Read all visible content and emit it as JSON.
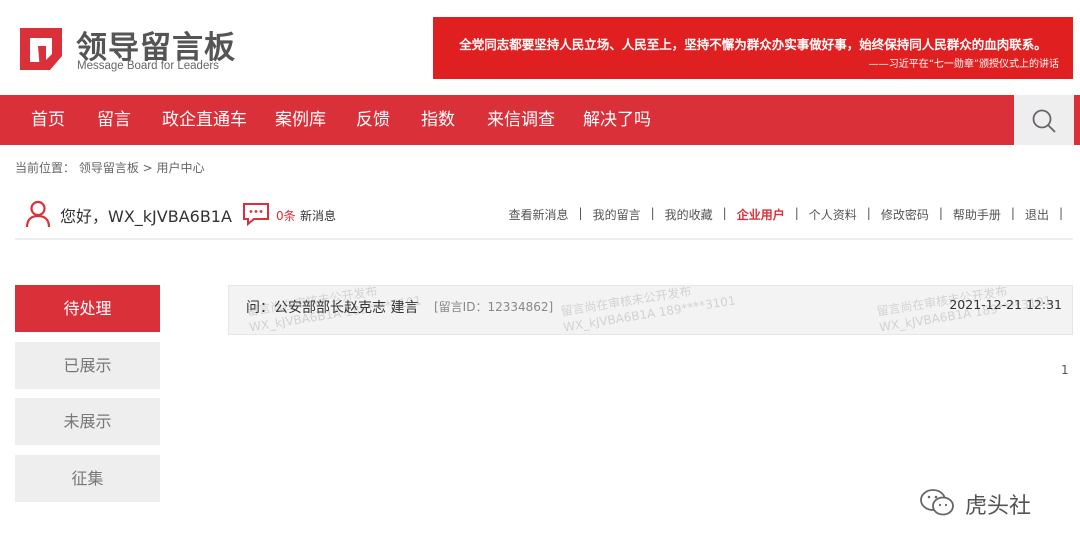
{
  "header": {
    "logo_title": "领导留言板",
    "logo_subtitle": "Message Board for Leaders",
    "banner_line1": "全党同志都要坚持人民立场、人民至上，坚持不懈为群众办实事做好事，始终保持同人民群众的血肉联系。",
    "banner_line2": "——习近平在“七一勋章”颁授仪式上的讲话"
  },
  "nav": {
    "items": [
      "首页",
      "留言",
      "政企直通车",
      "案例库",
      "反馈",
      "指数",
      "来信调查",
      "解决了吗"
    ],
    "search_icon": "search-icon"
  },
  "breadcrumb": "当前位置： 领导留言板 > 用户中心",
  "user": {
    "greeting": "您好，WX_kJVBA6B1A",
    "new_count": "0条",
    "new_label": "新消息",
    "links": [
      "查看新消息",
      "我的留言",
      "我的收藏",
      "企业用户",
      "个人资料",
      "修改密码",
      "帮助手册",
      "退出"
    ],
    "active_link": "企业用户"
  },
  "sidebar": {
    "items": [
      "待处理",
      "已展示",
      "未展示",
      "征集"
    ],
    "active": "待处理"
  },
  "messages": [
    {
      "title": "问：公安部部长赵克志 建言",
      "id_label": "[留言ID：12334862]",
      "time": "2021-12-21 12:31",
      "watermark_line1": "留言尚在审核未公开发布",
      "watermark_line2": "WX_kJVBA6B1A 189****3101"
    }
  ],
  "pagination": {
    "current": "1"
  },
  "signature": {
    "text": "虎头社"
  },
  "colors": {
    "accent": "#d9303a",
    "banner": "#e02020",
    "sidebar_inactive": "#eeeeee"
  }
}
